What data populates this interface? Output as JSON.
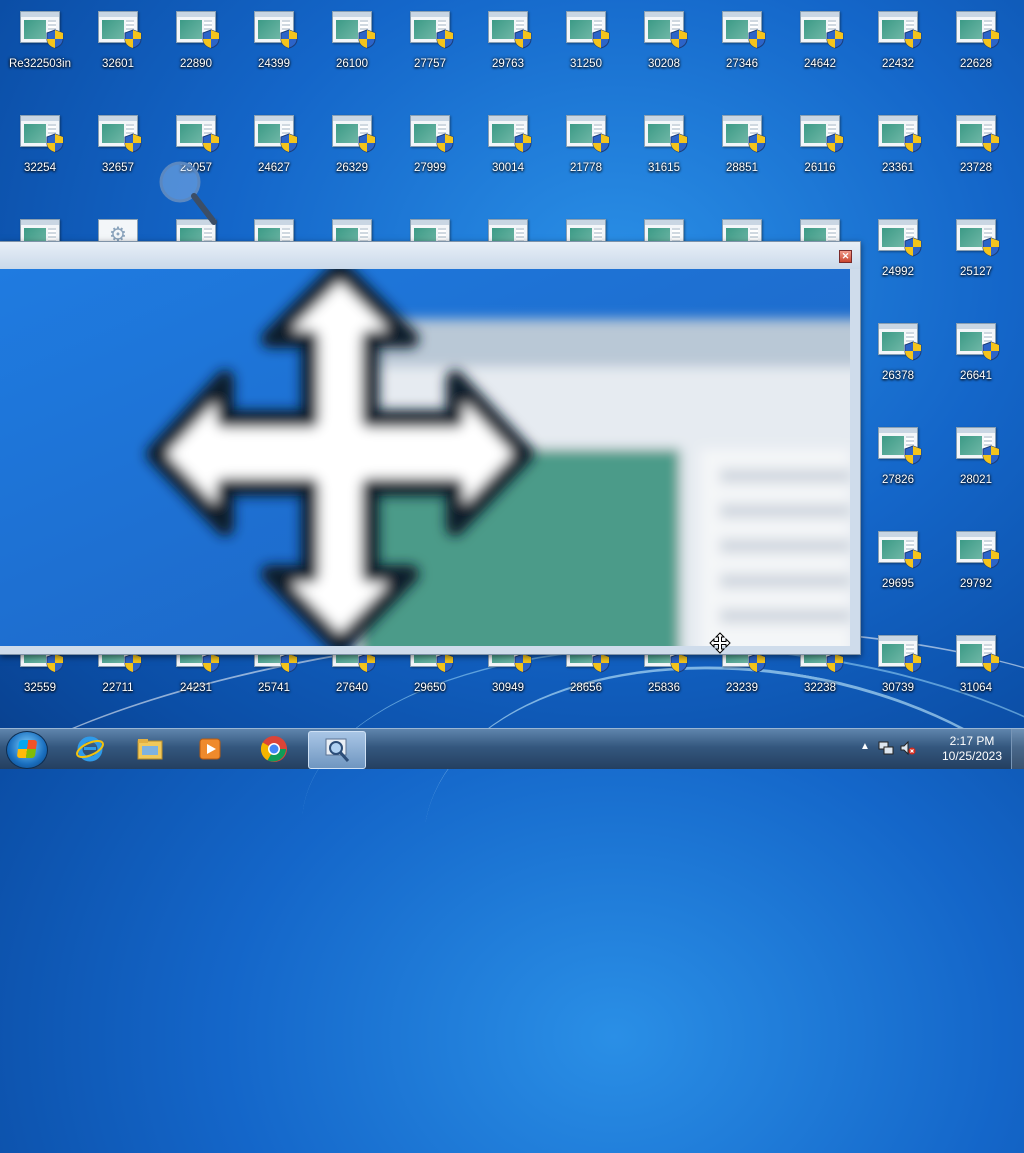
{
  "desktop": {
    "icons_row1": [
      "32250",
      "32601",
      "22890",
      "24399",
      "26100",
      "27757",
      "29763",
      "31250",
      "30208",
      "27346",
      "24642",
      "22432",
      "22628"
    ],
    "recycle_overlap_prefix": "Re",
    "recycle_overlap_suffix": "3in",
    "icons_row2": [
      "32254",
      "32657",
      "23057",
      "24627",
      "26329",
      "27999",
      "30014",
      "21778",
      "31615",
      "28851",
      "26116",
      "23361",
      "23728"
    ],
    "icons_right_col_a": [
      "24992",
      "26378",
      "27826",
      "29695"
    ],
    "icons_right_col_b": [
      "25127",
      "26641",
      "28021",
      "29792"
    ],
    "icons_bottom_row": [
      "32559",
      "22711",
      "24231",
      "25741",
      "27640",
      "29650",
      "30949",
      "28656",
      "25836",
      "23239",
      "32238",
      "30739",
      "31064"
    ]
  },
  "magnifier": {
    "close_label": "✕"
  },
  "taskbar": {
    "items": [
      "start-button",
      "internet-explorer",
      "file-explorer",
      "media-player",
      "chrome",
      "magnifier"
    ],
    "clock_time": "2:17 PM",
    "clock_date": "10/25/2023",
    "tray_arrow": "▲"
  },
  "colors": {
    "desktop_blue": "#1466c9",
    "taskbar": "#34577e",
    "magnifier_frame": "#cfdceb"
  }
}
